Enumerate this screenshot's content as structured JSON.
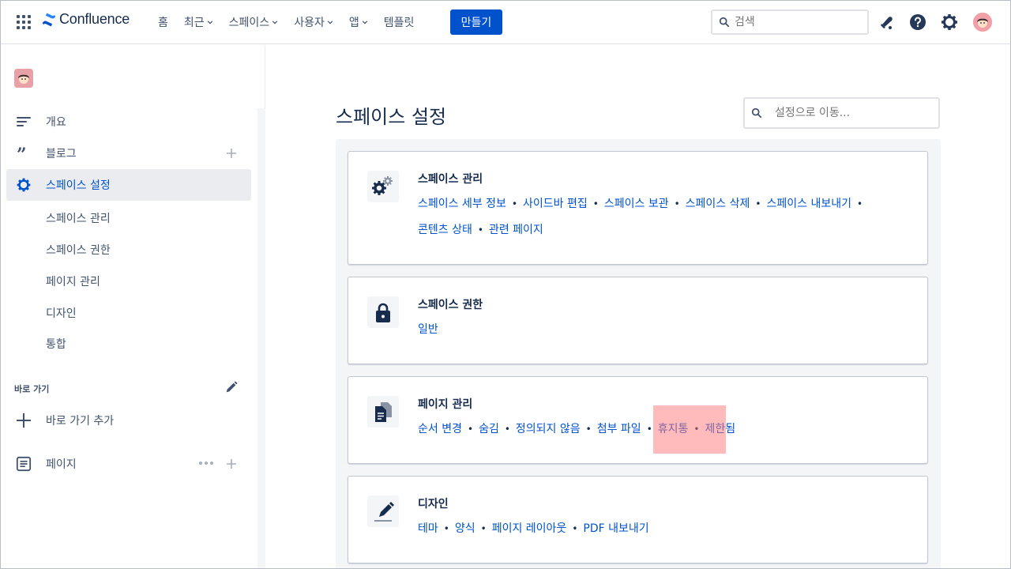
{
  "topnav": {
    "brand": "Confluence",
    "items": [
      {
        "label": "홈",
        "dropdown": false
      },
      {
        "label": "최근",
        "dropdown": true
      },
      {
        "label": "스페이스",
        "dropdown": true
      },
      {
        "label": "사용자",
        "dropdown": true
      },
      {
        "label": "앱",
        "dropdown": true
      },
      {
        "label": "템플릿",
        "dropdown": false
      }
    ],
    "create_label": "만들기",
    "search_placeholder": "검색",
    "accent": "#0052cc"
  },
  "sidebar": {
    "items": [
      {
        "label": "개요",
        "icon": "overview-icon"
      },
      {
        "label": "블로그",
        "icon": "quote-icon"
      },
      {
        "label": "스페이스 설정",
        "icon": "gear-icon",
        "active": true
      }
    ],
    "subitems": [
      "스페이스 관리",
      "스페이스 권한",
      "페이지 관리",
      "디자인",
      "통합"
    ],
    "shortcuts_heading": "바로 가기",
    "add_shortcut_label": "바로 가기 추가",
    "pages_label": "페이지"
  },
  "main": {
    "title": "스페이스 설정",
    "search_placeholder": "설정으로 이동...",
    "cards": [
      {
        "title": "스페이스 관리",
        "icon": "gears-icon",
        "links": [
          [
            "스페이스 세부 정보",
            "사이드바 편집",
            "스페이스 보관",
            "스페이스 삭제",
            "스페이스 내보내기"
          ],
          [
            "콘텐츠 상태",
            "관련 페이지"
          ]
        ]
      },
      {
        "title": "스페이스 권한",
        "icon": "lock-icon",
        "links": [
          [
            "일반"
          ]
        ]
      },
      {
        "title": "페이지 관리",
        "icon": "pages-icon",
        "links": [
          [
            "순서 변경",
            "숨김",
            "정의되지 않음",
            "첨부 파일",
            "휴지통",
            "제한됨"
          ]
        ]
      },
      {
        "title": "디자인",
        "icon": "pen-icon",
        "links": [
          [
            "테마",
            "양식",
            "페이지 레이아웃",
            "PDF 내보내기"
          ]
        ]
      }
    ]
  }
}
